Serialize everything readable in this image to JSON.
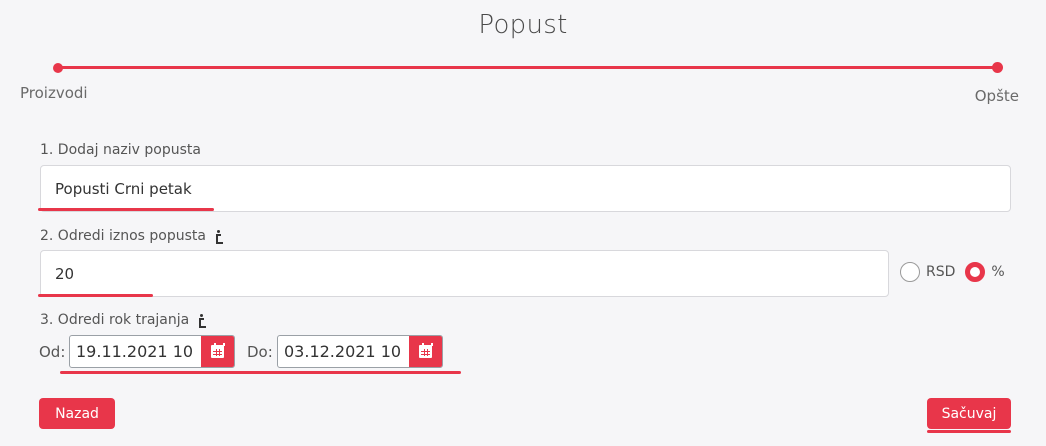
{
  "page": {
    "title": "Popust"
  },
  "stepper": {
    "steps": [
      {
        "label": "Proizvodi"
      },
      {
        "label": "Opšte"
      }
    ]
  },
  "form": {
    "name_field": {
      "label": "1. Dodaj naziv popusta",
      "value": "Popusti Crni petak"
    },
    "amount_field": {
      "label": "2. Odredi iznos popusta",
      "value": "20",
      "options": [
        {
          "label": "RSD",
          "checked": false
        },
        {
          "label": "%",
          "checked": true
        }
      ]
    },
    "duration_field": {
      "label": "3. Odredi rok trajanja",
      "from_label": "Od:",
      "from_value": "19.11.2021 10",
      "to_label": "Do:",
      "to_value": "03.12.2021 10"
    }
  },
  "buttons": {
    "back": "Nazad",
    "save": "Sačuvaj"
  },
  "colors": {
    "accent": "#e8364a",
    "background": "#f6f6f8"
  },
  "icons": {
    "info": "info-icon",
    "calendar": "calendar-icon"
  }
}
